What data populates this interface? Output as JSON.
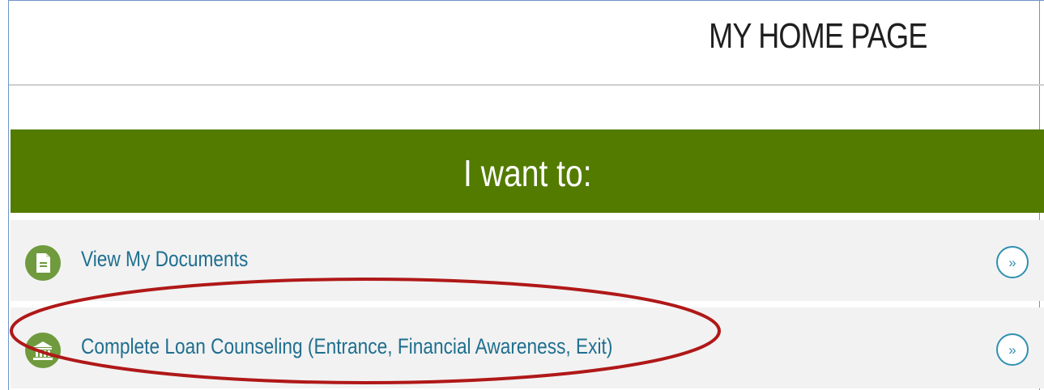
{
  "header": {
    "title": "MY HOME PAGE"
  },
  "banner": {
    "text": "I want to:",
    "color": "#527b00"
  },
  "actions": [
    {
      "label": "View My Documents",
      "icon": "document-icon"
    },
    {
      "label": "Complete Loan Counseling (Entrance, Financial Awareness, Exit)",
      "icon": "bank-building-icon"
    }
  ],
  "go_glyph": "»",
  "colors": {
    "link": "#1f6f8f",
    "icon_bg": "#6f9a3d",
    "go_button": "#2f90b0",
    "annotation": "#b01818",
    "row_bg": "#f2f2f2"
  },
  "annotation": {
    "type": "red-ellipse-highlight",
    "target": "actions.1"
  }
}
